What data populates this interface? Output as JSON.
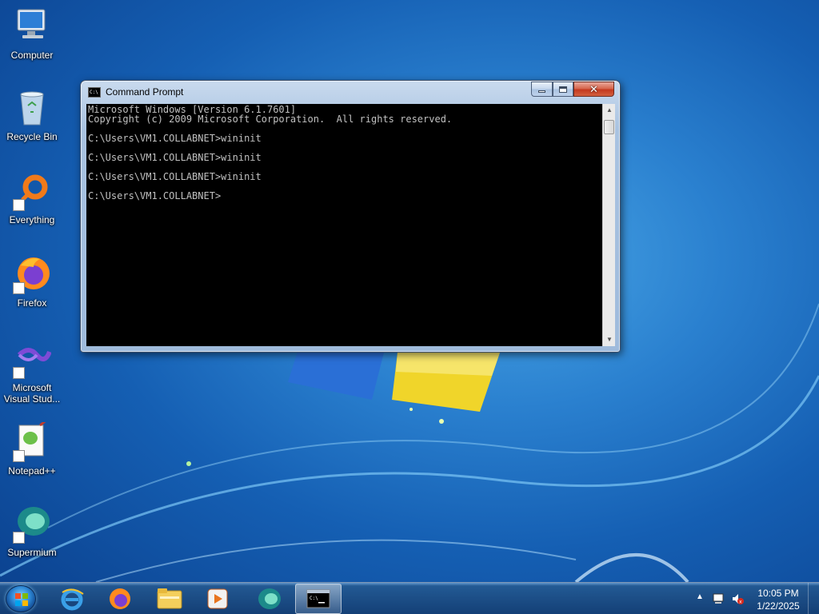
{
  "desktop": {
    "icons": [
      {
        "label": "Computer"
      },
      {
        "label": "Recycle Bin"
      },
      {
        "label": "Everything"
      },
      {
        "label": "Firefox"
      },
      {
        "label": "Microsoft Visual Stud..."
      },
      {
        "label": "Notepad++"
      },
      {
        "label": "Supermium"
      }
    ]
  },
  "cmd": {
    "title": "Command Prompt",
    "lines": [
      "Microsoft Windows [Version 6.1.7601]",
      "Copyright (c) 2009 Microsoft Corporation.  All rights reserved.",
      "C:\\Users\\VM1.COLLABNET>wininit",
      "C:\\Users\\VM1.COLLABNET>wininit",
      "C:\\Users\\VM1.COLLABNET>wininit",
      "C:\\Users\\VM1.COLLABNET>"
    ],
    "icon_text": "C:\\"
  },
  "taskbar": {
    "pinned": [
      "internet-explorer",
      "firefox",
      "file-explorer",
      "media-player",
      "supermium",
      "command-prompt"
    ],
    "active": "command-prompt",
    "clock": {
      "time": "10:05 PM",
      "date": "1/22/2025"
    }
  },
  "colors": {
    "console_bg": "#000000",
    "console_text": "#c0c0c0",
    "close_button": "#c4391f"
  }
}
